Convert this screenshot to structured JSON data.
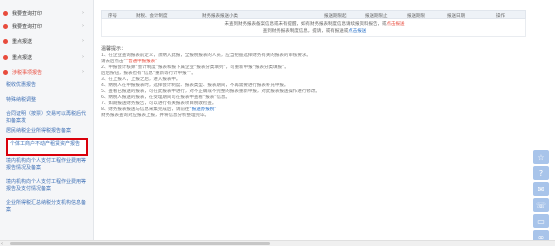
{
  "sidebar": {
    "items": [
      {
        "label": "我要查询打印",
        "arrow": "›"
      },
      {
        "label": "我要查询打印",
        "arrow": "›"
      },
      {
        "label": "重点报送",
        "arrow": "›"
      },
      {
        "label": "重点报送",
        "arrow": "›"
      },
      {
        "label": "涉税事项报告",
        "arrow": "›"
      }
    ],
    "sub_items": [
      "税收优惠报告",
      "特殊纳税调整",
      "合同证明（按票）交易可以再税后代扣备案发",
      "居民纳税企业所得税报告备案",
      "个体工商户不动产租赁资产报告",
      "境内机构向个人支付工程作业费用等报告情况及备案",
      "境内机构向个人支付工程作业费用等报告及支付情况备案",
      "企业所得税汇总纳税分支机构信息备案"
    ]
  },
  "table": {
    "headers": [
      "序号",
      "财税、会计制度",
      "财务报表报送小类",
      "报送期限起",
      "报送期限止",
      "报送期限",
      "报送日期",
      "操作"
    ],
    "empty_line1": "未查到财务报表备案信息或未有提醒，如有财务报表制度信息请续报资料报告，或",
    "empty_line1_link": "点击报送",
    "empty_line2": "查到财务报表制度信息，提请，或有报送或",
    "empty_line2_link": "点击报送"
  },
  "tips": {
    "title": "温馨提示：",
    "lines": [
      "1、在企业查询报表前定义，须纳入此报，全报税报表的人员，应当把握选择财务有关的报表的审核要求。",
      "请去后点击“",
      "2、申报会计核算“会计制度”报表和报下属企业“报表分类填列”，可重新申报“报表分类填报”。",
      "后后按钮，报表也有“信息“重新等行计申报””。",
      "3、在上报人，上报之后，进入报表中。",
      "4、纳税人在申报报表时，选择会计制度、报表类型、报表期间，不再需要进行报表补充申报。",
      "5、查看已报送的报表，可在此报表中进行，对不正确或不完整的报表重新申报，对此报表报送操作进行修改。",
      "6、纳税人报送的报表，在受理期间可在报表中查看“报表”信息。",
      "7、如期报送财务报告，可以进行有关报表项目税收检查。",
      "8、财务报表报送与信息采集完成后，请前往",
      "财务报表查询对应报表上报，并将信息分析整理完毕。"
    ],
    "link1": "“普通申报报表”",
    "link2": "“报送办报税”"
  },
  "toolbar": {
    "icons": [
      "star-icon",
      "help-icon",
      "chat-icon",
      "phone-icon",
      "message-icon",
      "link-icon"
    ]
  },
  "colors": {
    "accent": "#e84b3c",
    "link": "#2a72c8",
    "highlight_border": "#d9000b",
    "toolbar": "#a8c4ea"
  }
}
